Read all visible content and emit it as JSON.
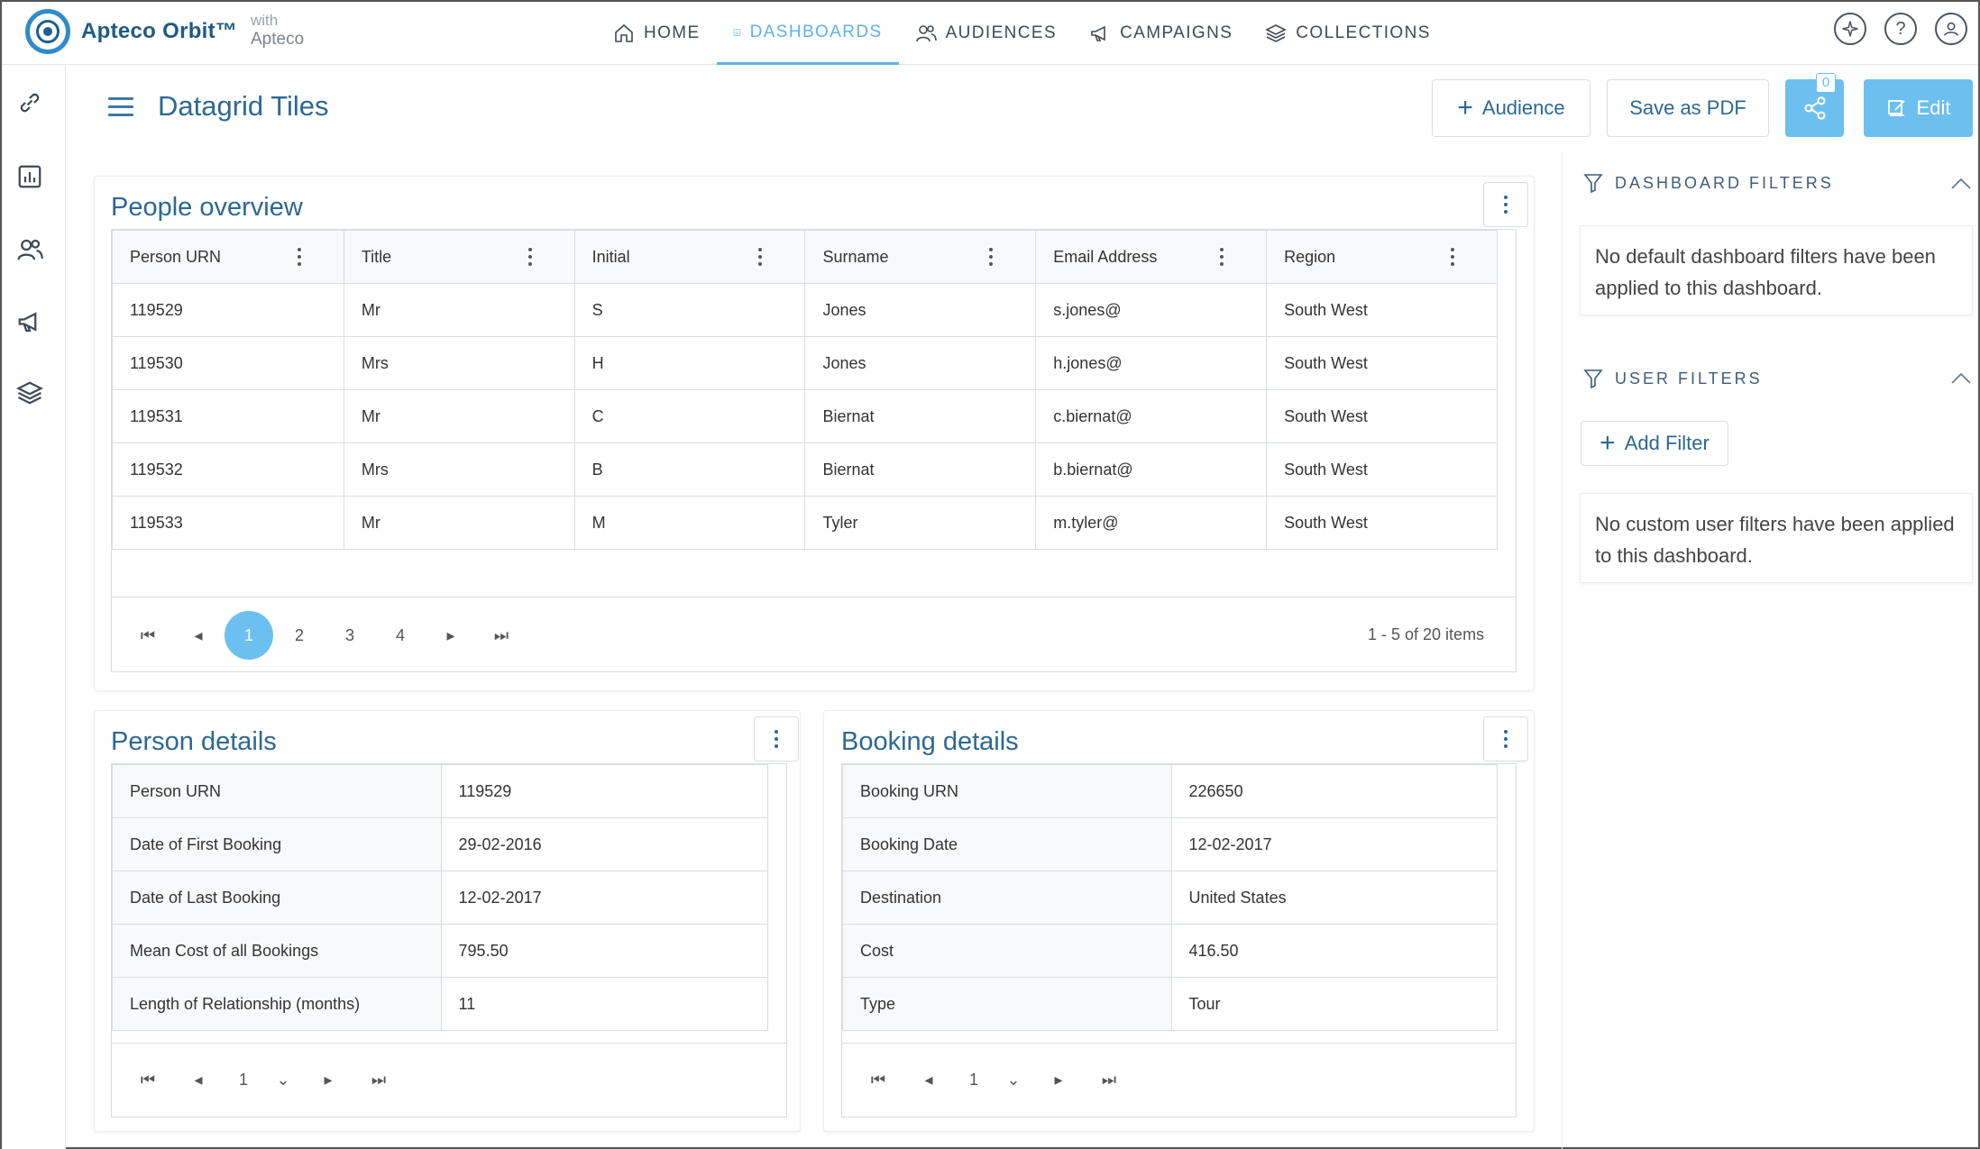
{
  "app": {
    "brand": "Apteco Orbit™",
    "with_label": "with",
    "with_company": "Apteco"
  },
  "nav": {
    "items": [
      {
        "label": "HOME",
        "icon": "home-icon"
      },
      {
        "label": "DASHBOARDS",
        "icon": "dashboard-icon",
        "active": true
      },
      {
        "label": "AUDIENCES",
        "icon": "audiences-icon"
      },
      {
        "label": "CAMPAIGNS",
        "icon": "megaphone-icon"
      },
      {
        "label": "COLLECTIONS",
        "icon": "layers-icon"
      }
    ],
    "right_icons": [
      "compass-icon",
      "help-icon",
      "user-icon"
    ],
    "help_glyph": "?"
  },
  "rail": {
    "icons": [
      "link-icon",
      "chart-icon",
      "people-icon",
      "megaphone-icon",
      "layers-icon"
    ]
  },
  "header": {
    "title": "Datagrid Tiles",
    "audience_button": "Audience",
    "pdf_button": "Save as PDF",
    "share_count": "0",
    "edit_button": "Edit",
    "accent_color": "#6cc0ef"
  },
  "people_overview": {
    "title": "People overview",
    "columns": [
      "Person URN",
      "Title",
      "Initial",
      "Surname",
      "Email Address",
      "Region"
    ],
    "rows": [
      [
        "119529",
        "Mr",
        "S",
        "Jones",
        "s.jones@",
        "South West"
      ],
      [
        "119530",
        "Mrs",
        "H",
        "Jones",
        "h.jones@",
        "South West"
      ],
      [
        "119531",
        "Mr",
        "C",
        "Biernat",
        "c.biernat@",
        "South West"
      ],
      [
        "119532",
        "Mrs",
        "B",
        "Biernat",
        "b.biernat@",
        "South West"
      ],
      [
        "119533",
        "Mr",
        "M",
        "Tyler",
        "m.tyler@",
        "South West"
      ]
    ],
    "pages": [
      "1",
      "2",
      "3",
      "4"
    ],
    "current_page": "1",
    "items_info": "1 - 5 of 20 items"
  },
  "person_details": {
    "title": "Person details",
    "rows": [
      [
        "Person URN",
        "119529"
      ],
      [
        "Date of First Booking",
        "29-02-2016"
      ],
      [
        "Date of Last Booking",
        "12-02-2017"
      ],
      [
        "Mean Cost of all Bookings",
        "795.50"
      ],
      [
        "Length of Relationship (months)",
        "11"
      ]
    ],
    "page": "1"
  },
  "booking_details": {
    "title": "Booking details",
    "rows": [
      [
        "Booking URN",
        "226650"
      ],
      [
        "Booking Date",
        "12-02-2017"
      ],
      [
        "Destination",
        "United States"
      ],
      [
        "Cost",
        "416.50"
      ],
      [
        "Type",
        "Tour"
      ]
    ],
    "page": "1"
  },
  "filters": {
    "dashboard_title": "DASHBOARD FILTERS",
    "dashboard_message": "No default dashboard filters have been applied to this dashboard.",
    "user_title": "USER FILTERS",
    "add_filter": "Add Filter",
    "user_message": "No custom user filters have been applied to this dashboard."
  }
}
